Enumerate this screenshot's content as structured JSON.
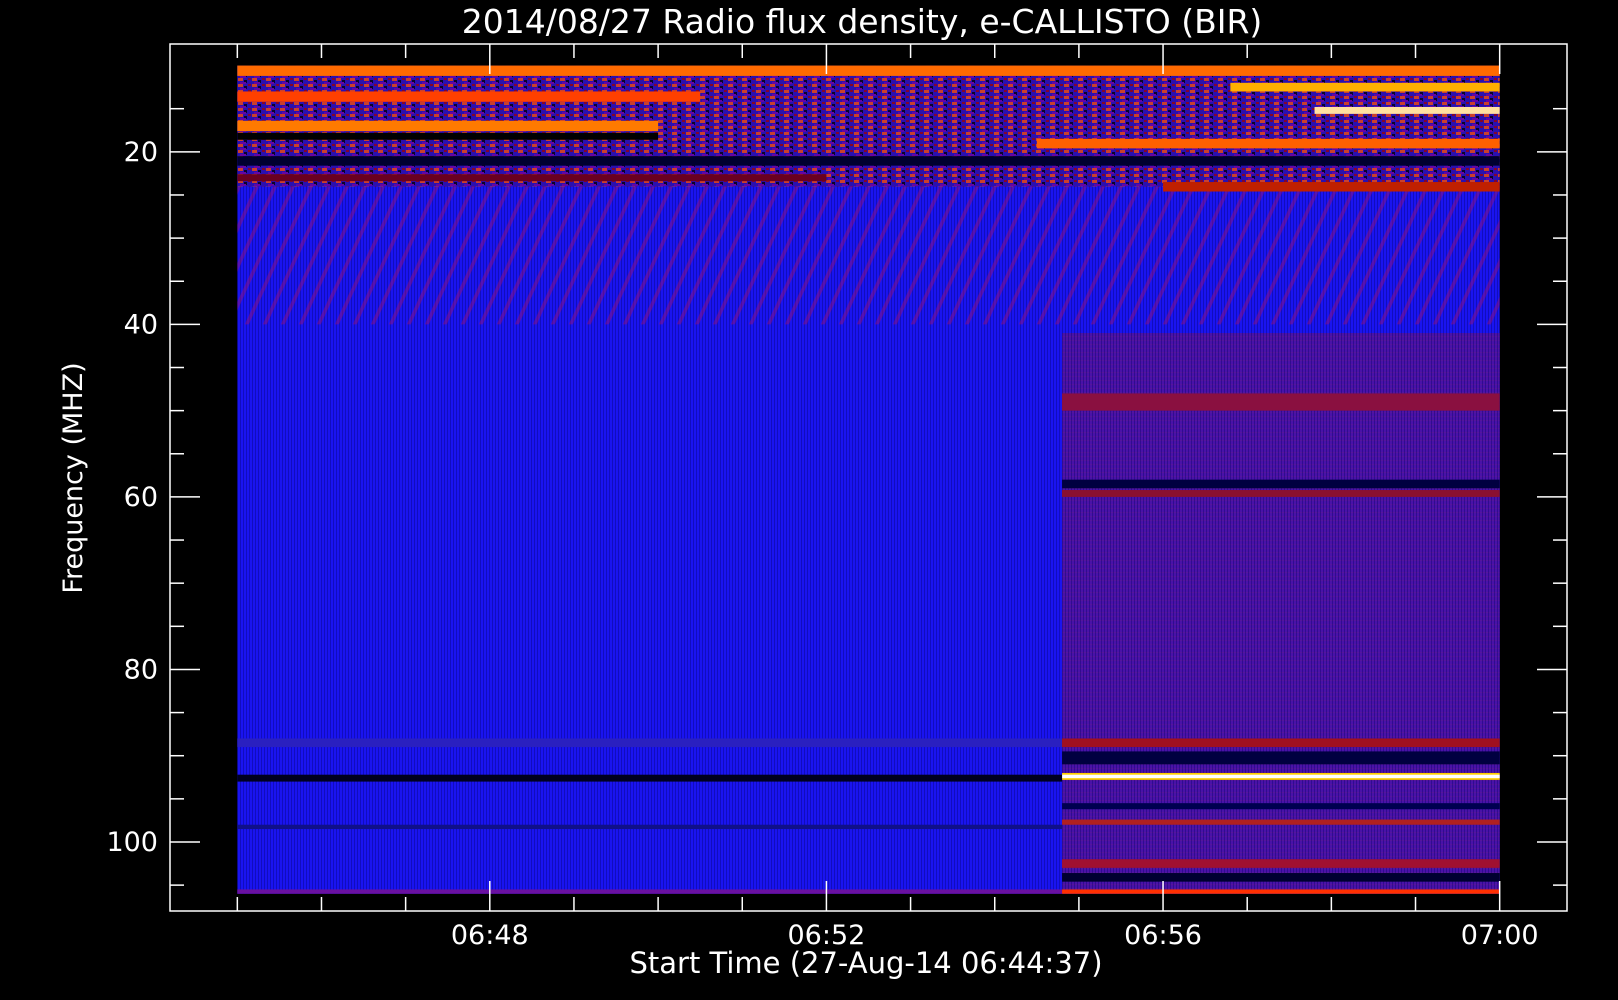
{
  "chart_data": {
    "type": "heatmap",
    "title": "2014/08/27  Radio flux density, e-CALLISTO (BIR)",
    "xlabel": "Start Time (27-Aug-14 06:44:37)",
    "ylabel": "Frequency (MHZ)",
    "x_tick_labels": [
      "06:48",
      "06:52",
      "06:56",
      "07:00"
    ],
    "y_tick_labels": [
      "20",
      "40",
      "60",
      "80",
      "100"
    ],
    "y_ticks_mhz": [
      20,
      40,
      60,
      80,
      100
    ],
    "y_minor_ticks_mhz": [
      15,
      25,
      30,
      35,
      45,
      50,
      55,
      65,
      70,
      75,
      85,
      90,
      95,
      105
    ],
    "x_tick_minutes": [
      48,
      52,
      56,
      60
    ],
    "x_minor_tick_minutes": [
      45,
      46,
      47,
      49,
      50,
      51,
      53,
      54,
      55,
      57,
      58,
      59
    ],
    "xlim_minutes_after_0600": [
      44.2,
      60.8
    ],
    "ylim_mhz": [
      108,
      7.5
    ],
    "data_time_range_minutes_after_0600": [
      45,
      60
    ],
    "data_freq_range_mhz": [
      10,
      106
    ],
    "receiver_gain_change_minute": 54.8,
    "colormap": [
      "#000000",
      "#0000ff",
      "#8b0000",
      "#ff4000",
      "#ffd000",
      "#ffffff"
    ],
    "features": [
      {
        "label": "strong RFI band",
        "freq_mhz": 92.3,
        "minutes": [
          54.8,
          60
        ]
      },
      {
        "label": "dark band",
        "freq_mhz": 18.2,
        "minutes": [
          45,
          50
        ]
      },
      {
        "label": "dark band",
        "freq_mhz": 92.5,
        "minutes": [
          45,
          54.8
        ]
      },
      {
        "label": "dark band",
        "freq_mhz": 58.5,
        "minutes": [
          54.8,
          60
        ]
      }
    ]
  }
}
